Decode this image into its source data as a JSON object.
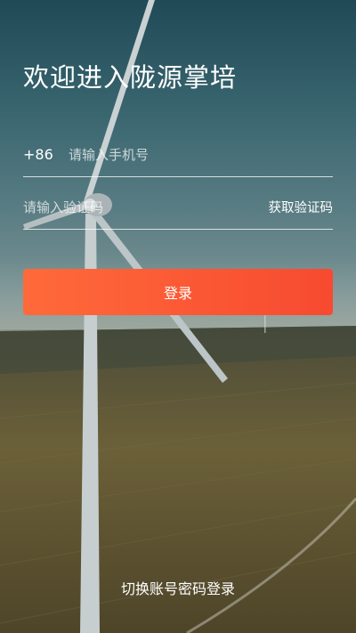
{
  "welcome": {
    "title": "欢迎进入陇源掌培"
  },
  "phone": {
    "country_code": "+86",
    "value": "",
    "placeholder": "请输入手机号"
  },
  "code": {
    "value": "",
    "placeholder": "请输入验证码",
    "get_code_label": "获取验证码"
  },
  "login": {
    "label": "登录"
  },
  "switch": {
    "label": "切换账号密码登录"
  },
  "colors": {
    "button_start": "#ff6a3a",
    "button_end": "#f74a30",
    "text": "#ffffff"
  }
}
